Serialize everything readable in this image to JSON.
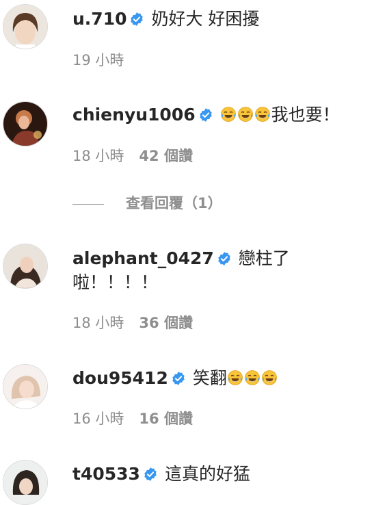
{
  "comments": [
    {
      "username": "u.710",
      "text": "奶好大 好困擾",
      "emoji_count": 0,
      "text_after_emoji": "",
      "time": "19 小時",
      "likes": ""
    },
    {
      "username": "chienyu1006",
      "text": "",
      "emoji_count": 3,
      "text_after_emoji": "我也要！",
      "time": "18 小時",
      "likes": "42 個讚",
      "view_replies": "查看回覆（1）"
    },
    {
      "username": "alephant_0427",
      "text": "戀柱了",
      "text_line2": "啦！！！！",
      "time": "18 小時",
      "likes": "36 個讚"
    },
    {
      "username": "dou95412",
      "text": "笑翻",
      "emoji_count": 3,
      "time": "16 小時",
      "likes": "16 個讚"
    },
    {
      "username": "t40533",
      "text": "這真的好猛"
    }
  ],
  "icons": {
    "verified": "verified-badge-icon",
    "emoji": "face-with-tears-of-joy-icon"
  },
  "colors": {
    "verified_blue": "#3897f0",
    "meta_gray": "#8e8e8e",
    "text": "#262626"
  }
}
